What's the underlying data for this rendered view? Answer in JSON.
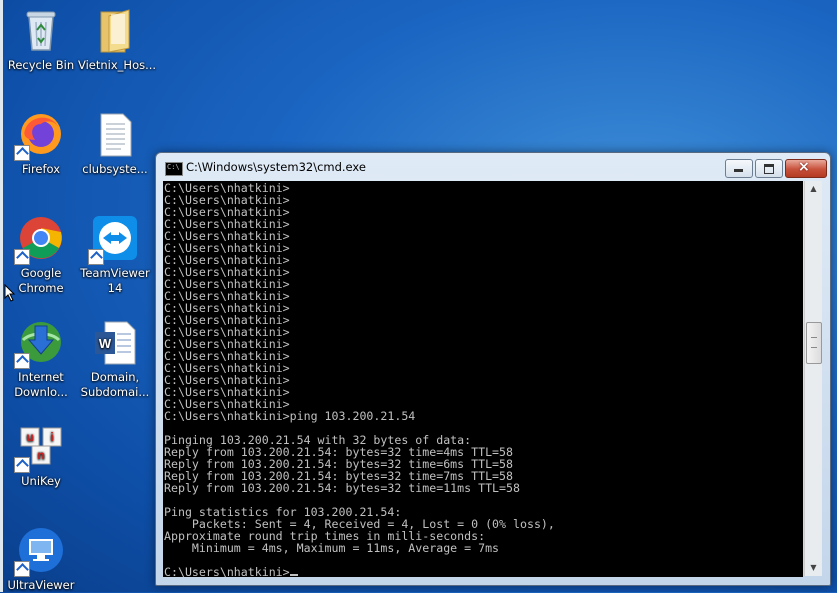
{
  "desktop": {
    "icons": [
      {
        "label": "Recycle Bin",
        "icon": "recycle-bin-icon"
      },
      {
        "label": "Vietnix_Hos...",
        "icon": "folder-icon"
      },
      {
        "label": "Firefox",
        "icon": "firefox-icon"
      },
      {
        "label": "clubsyste...",
        "icon": "text-file-icon"
      },
      {
        "label": "Google Chrome",
        "icon": "chrome-icon"
      },
      {
        "label": "TeamViewer 14",
        "icon": "teamviewer-icon"
      },
      {
        "label": "Internet Downlo...",
        "icon": "idm-icon"
      },
      {
        "label": "Domain, Subdomai...",
        "icon": "word-document-icon"
      },
      {
        "label": "UniKey",
        "icon": "unikey-icon"
      },
      {
        "label": "UltraViewer",
        "icon": "ultraviewer-icon"
      }
    ]
  },
  "cmd": {
    "title": "C:\\Windows\\system32\\cmd.exe",
    "title_icon_text": "C:\\",
    "controls": {
      "minimize": "minimize-icon",
      "maximize": "maximize-icon",
      "close": "×"
    },
    "lines": [
      "C:\\Users\\nhatkini>",
      "C:\\Users\\nhatkini>",
      "C:\\Users\\nhatkini>",
      "C:\\Users\\nhatkini>",
      "C:\\Users\\nhatkini>",
      "C:\\Users\\nhatkini>",
      "C:\\Users\\nhatkini>",
      "C:\\Users\\nhatkini>",
      "C:\\Users\\nhatkini>",
      "C:\\Users\\nhatkini>",
      "C:\\Users\\nhatkini>",
      "C:\\Users\\nhatkini>",
      "C:\\Users\\nhatkini>",
      "C:\\Users\\nhatkini>",
      "C:\\Users\\nhatkini>",
      "C:\\Users\\nhatkini>",
      "C:\\Users\\nhatkini>",
      "C:\\Users\\nhatkini>",
      "C:\\Users\\nhatkini>",
      "C:\\Users\\nhatkini>ping 103.200.21.54",
      "",
      "Pinging 103.200.21.54 with 32 bytes of data:",
      "Reply from 103.200.21.54: bytes=32 time=4ms TTL=58",
      "Reply from 103.200.21.54: bytes=32 time=6ms TTL=58",
      "Reply from 103.200.21.54: bytes=32 time=7ms TTL=58",
      "Reply from 103.200.21.54: bytes=32 time=11ms TTL=58",
      "",
      "Ping statistics for 103.200.21.54:",
      "    Packets: Sent = 4, Received = 4, Lost = 0 (0% loss),",
      "Approximate round trip times in milli-seconds:",
      "    Minimum = 4ms, Maximum = 11ms, Average = 7ms",
      "",
      "C:\\Users\\nhatkini>"
    ]
  },
  "colors": {
    "desktop_bg": "#1b66c2",
    "console_bg": "#000000",
    "console_text": "#c0c0c0",
    "close_button": "#c7513b"
  }
}
